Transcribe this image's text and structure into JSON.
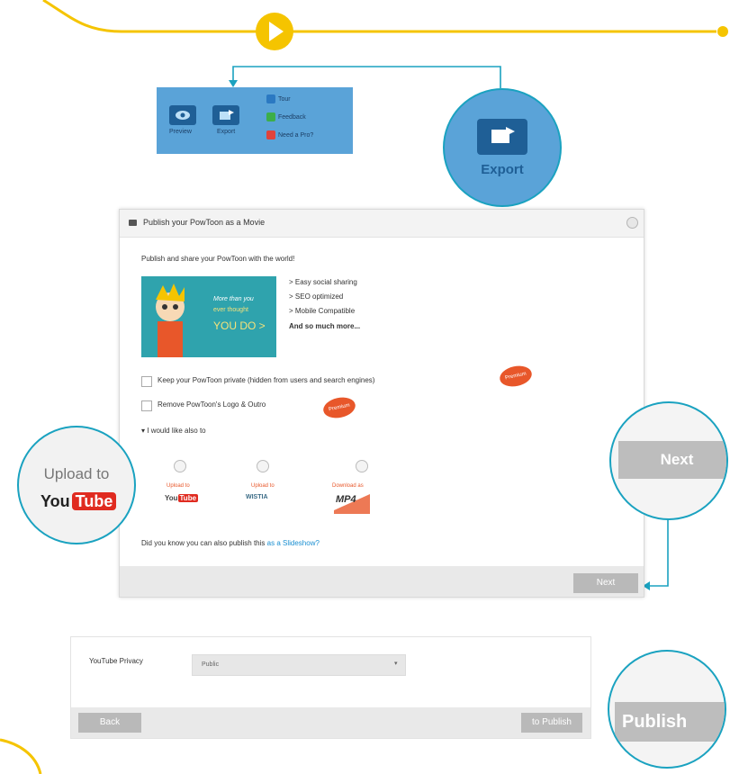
{
  "colors": {
    "accent_yellow": "#f5c400",
    "teal": "#1aa2c0",
    "toolbar_blue": "#5aa3d8",
    "promo_teal": "#2fa3ad",
    "badge_orange": "#e8572a",
    "youtube_red": "#e02b20"
  },
  "toolbar": {
    "preview_label": "Preview",
    "export_label": "Export",
    "side_items": [
      {
        "label": "Tour",
        "color": "#2b79c2",
        "icon": "tour-icon"
      },
      {
        "label": "Feedback",
        "color": "#3cae4a",
        "icon": "feedback-icon"
      },
      {
        "label": "Need a Pro?",
        "color": "#e0433b",
        "icon": "pro-icon"
      }
    ]
  },
  "export_zoom": {
    "label": "Export"
  },
  "dialog": {
    "title": "Publish your PowToon as a Movie",
    "intro": "Publish and share your PowToon with the world!",
    "promo_text": [
      "More than you",
      "ever thought",
      "YOU DO >"
    ],
    "features": [
      "> Easy social sharing",
      "> SEO optimized",
      "> Mobile Compatible",
      "And so much more..."
    ],
    "option_private": "Keep your PowToon private (hidden from users and search engines)",
    "option_logo": "Remove PowToon's Logo & Outro",
    "badge": "Premium",
    "collapse_label": "I would like also to",
    "destinations": [
      {
        "caption": "Upload to",
        "brand": "YouTube"
      },
      {
        "caption": "Upload to",
        "brand": "WISTIA"
      },
      {
        "caption": "Download as",
        "brand": "MP4"
      }
    ],
    "slideshow_text": "Did you know you can also publish this",
    "slideshow_link": "as a Slideshow?",
    "next_label": "Next"
  },
  "upload_zoom": {
    "caption": "Upload to",
    "brand_you": "You",
    "brand_tube": "Tube"
  },
  "next_zoom": {
    "label": "Next"
  },
  "privacy_panel": {
    "field_label": "YouTube Privacy",
    "selected_value": "Public",
    "back_label": "Back",
    "publish_label": "to Publish"
  },
  "publish_zoom": {
    "label": "Publish"
  }
}
